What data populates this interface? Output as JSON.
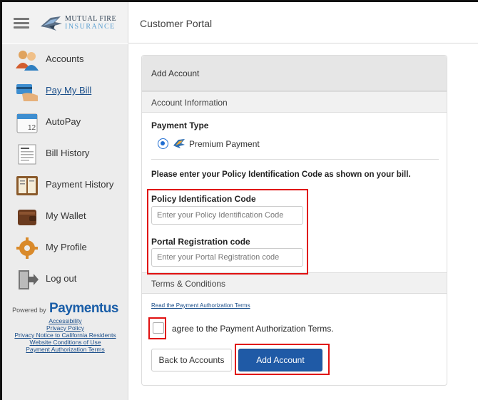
{
  "header": {
    "logo_line1": "MUTUAL FIRE",
    "logo_line2": "INSURANCE",
    "portal_title": "Customer Portal"
  },
  "sidebar": {
    "items": [
      {
        "label": "Accounts",
        "icon": "users-icon"
      },
      {
        "label": "Pay My Bill",
        "icon": "credit-card-hand-icon"
      },
      {
        "label": "AutoPay",
        "icon": "calendar-icon"
      },
      {
        "label": "Bill History",
        "icon": "invoice-icon"
      },
      {
        "label": "Payment History",
        "icon": "ledger-icon"
      },
      {
        "label": "My Wallet",
        "icon": "wallet-icon"
      },
      {
        "label": "My Profile",
        "icon": "gear-icon"
      },
      {
        "label": "Log out",
        "icon": "logout-door-icon"
      }
    ],
    "powered_by": "Powered by",
    "brand": "Paymentus",
    "footer_links": [
      "Accessibility",
      "Privacy Policy",
      "Privacy Notice to California Residents",
      "Website Conditions of Use",
      "Payment Authorization Terms"
    ]
  },
  "card": {
    "title": "Add Account",
    "section_account_info": "Account Information",
    "payment_type_label": "Payment Type",
    "payment_option": "Premium Payment",
    "instruction": "Please enter your Policy Identification Code as shown on your bill.",
    "policy_code_label": "Policy Identification Code",
    "policy_code_placeholder": "Enter your Policy Identification Code",
    "portal_code_label": "Portal Registration code",
    "portal_code_placeholder": "Enter your Portal Registration code",
    "section_terms": "Terms & Conditions",
    "terms_link": "Read the Payment Authorization Terms",
    "agree_text": "agree to the Payment Authorization Terms.",
    "back_button": "Back to Accounts",
    "add_button": "Add Account"
  },
  "colors": {
    "accent": "#1f5aa6",
    "highlight": "#e01010",
    "sidebar_bg": "#ececec"
  }
}
